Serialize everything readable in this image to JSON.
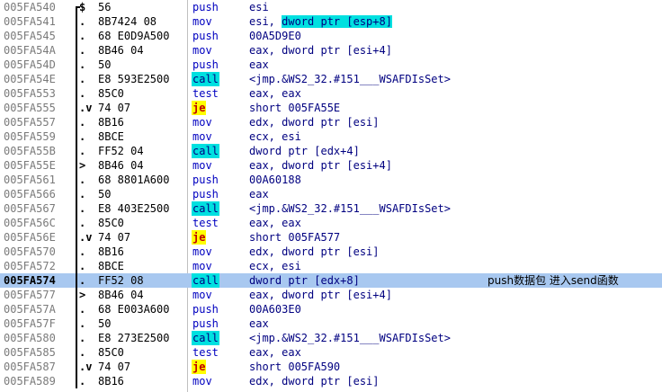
{
  "rows": [
    {
      "address": "005FA540",
      "mark": "$",
      "hex": "56",
      "mnemonic": "push",
      "operands": "esi"
    },
    {
      "address": "005FA541",
      "mark": ".",
      "hex": "8B7424 08",
      "mnemonic": "mov",
      "operands_pre": "esi, ",
      "operands_hl": "dword ptr [esp+8]"
    },
    {
      "address": "005FA545",
      "mark": ".",
      "hex": "68 E0D9A500",
      "mnemonic": "push",
      "operands": "00A5D9E0"
    },
    {
      "address": "005FA54A",
      "mark": ".",
      "hex": "8B46 04",
      "mnemonic": "mov",
      "operands": "eax, dword ptr [esi+4]"
    },
    {
      "address": "005FA54D",
      "mark": ".",
      "hex": "50",
      "mnemonic": "push",
      "operands": "eax"
    },
    {
      "address": "005FA54E",
      "mark": ".",
      "hex": "E8 593E2500",
      "mnemonic": "call",
      "operands": "<jmp.&WS2_32.#151___WSAFDIsSet>"
    },
    {
      "address": "005FA553",
      "mark": ".",
      "hex": "85C0",
      "mnemonic": "test",
      "operands": "eax, eax"
    },
    {
      "address": "005FA555",
      "mark": ".v",
      "hex": "74 07",
      "mnemonic": "je",
      "operands": "short 005FA55E"
    },
    {
      "address": "005FA557",
      "mark": ".",
      "hex": "8B16",
      "mnemonic": "mov",
      "operands": "edx, dword ptr [esi]"
    },
    {
      "address": "005FA559",
      "mark": ".",
      "hex": "8BCE",
      "mnemonic": "mov",
      "operands": "ecx, esi"
    },
    {
      "address": "005FA55B",
      "mark": ".",
      "hex": "FF52 04",
      "mnemonic": "call",
      "operands": "dword ptr [edx+4]"
    },
    {
      "address": "005FA55E",
      "mark": ">",
      "hex": "8B46 04",
      "mnemonic": "mov",
      "operands": "eax, dword ptr [esi+4]"
    },
    {
      "address": "005FA561",
      "mark": ".",
      "hex": "68 8801A600",
      "mnemonic": "push",
      "operands": "00A60188"
    },
    {
      "address": "005FA566",
      "mark": ".",
      "hex": "50",
      "mnemonic": "push",
      "operands": "eax"
    },
    {
      "address": "005FA567",
      "mark": ".",
      "hex": "E8 403E2500",
      "mnemonic": "call",
      "operands": "<jmp.&WS2_32.#151___WSAFDIsSet>"
    },
    {
      "address": "005FA56C",
      "mark": ".",
      "hex": "85C0",
      "mnemonic": "test",
      "operands": "eax, eax"
    },
    {
      "address": "005FA56E",
      "mark": ".v",
      "hex": "74 07",
      "mnemonic": "je",
      "operands": "short 005FA577"
    },
    {
      "address": "005FA570",
      "mark": ".",
      "hex": "8B16",
      "mnemonic": "mov",
      "operands": "edx, dword ptr [esi]"
    },
    {
      "address": "005FA572",
      "mark": ".",
      "hex": "8BCE",
      "mnemonic": "mov",
      "operands": "ecx, esi"
    },
    {
      "address": "005FA574",
      "mark": ".",
      "hex": "FF52 08",
      "mnemonic": "call",
      "operands": "dword ptr [edx+8]",
      "comment": "push数据包 进入send函数",
      "selected": true
    },
    {
      "address": "005FA577",
      "mark": ">",
      "hex": "8B46 04",
      "mnemonic": "mov",
      "operands": "eax, dword ptr [esi+4]"
    },
    {
      "address": "005FA57A",
      "mark": ".",
      "hex": "68 E003A600",
      "mnemonic": "push",
      "operands": "00A603E0"
    },
    {
      "address": "005FA57F",
      "mark": ".",
      "hex": "50",
      "mnemonic": "push",
      "operands": "eax"
    },
    {
      "address": "005FA580",
      "mark": ".",
      "hex": "E8 273E2500",
      "mnemonic": "call",
      "operands": "<jmp.&WS2_32.#151___WSAFDIsSet>"
    },
    {
      "address": "005FA585",
      "mark": ".",
      "hex": "85C0",
      "mnemonic": "test",
      "operands": "eax, eax"
    },
    {
      "address": "005FA587",
      "mark": ".v",
      "hex": "74 07",
      "mnemonic": "je",
      "operands": "short 005FA590"
    },
    {
      "address": "005FA589",
      "mark": ".",
      "hex": "8B16",
      "mnemonic": "mov",
      "operands": "edx, dword ptr [esi]"
    }
  ],
  "colors": {
    "selected_row": "#a8c8f0",
    "call_highlight": "#00e0e0",
    "jump_highlight": "#ffff00",
    "address_text": "#7a7a7a",
    "mnemonic_text": "#0000c0"
  }
}
